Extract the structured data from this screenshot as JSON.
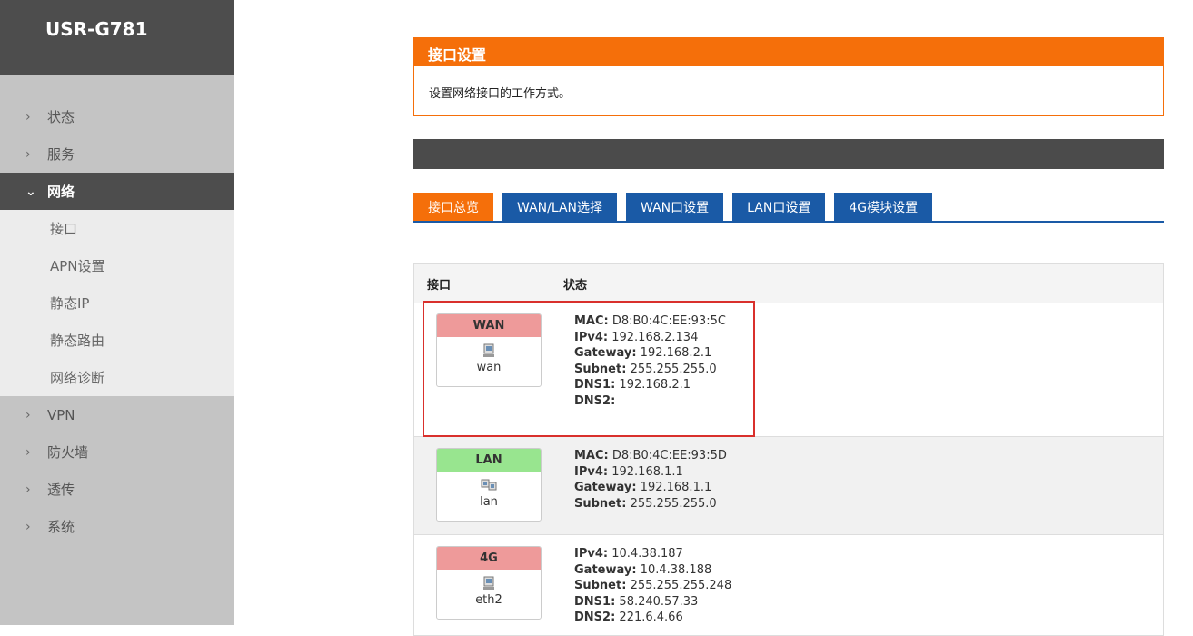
{
  "sidebar": {
    "brand": "USR-G781",
    "menu": [
      {
        "label": "状态",
        "chev": "›"
      },
      {
        "label": "服务",
        "chev": "›"
      }
    ],
    "active": {
      "label": "网络",
      "chev": "⌄"
    },
    "subitems": [
      "接口",
      "APN设置",
      "静态IP",
      "静态路由",
      "网络诊断"
    ],
    "menu_after": [
      {
        "label": "VPN",
        "chev": "›"
      },
      {
        "label": "防火墙",
        "chev": "›"
      },
      {
        "label": "透传",
        "chev": "›"
      },
      {
        "label": "系统",
        "chev": "›"
      }
    ]
  },
  "panel": {
    "title": "接口设置",
    "description": "设置网络接口的工作方式。"
  },
  "tabs": [
    "接口总览",
    "WAN/LAN选择",
    "WAN口设置",
    "LAN口设置",
    "4G模块设置"
  ],
  "table": {
    "headers": [
      "接口",
      "状态"
    ],
    "rows": [
      {
        "label": "WAN",
        "color": "#ee9a9a",
        "iface": "wan",
        "status": [
          [
            "MAC:",
            "D8:B0:4C:EE:93:5C"
          ],
          [
            "IPv4:",
            "192.168.2.134"
          ],
          [
            "Gateway:",
            "192.168.2.1"
          ],
          [
            "Subnet:",
            "255.255.255.0"
          ],
          [
            "DNS1:",
            "192.168.2.1"
          ],
          [
            "DNS2:",
            ""
          ]
        ]
      },
      {
        "label": "LAN",
        "color": "#98e58f",
        "iface": "lan",
        "status": [
          [
            "MAC:",
            "D8:B0:4C:EE:93:5D"
          ],
          [
            "IPv4:",
            "192.168.1.1"
          ],
          [
            "Gateway:",
            "192.168.1.1"
          ],
          [
            "Subnet:",
            "255.255.255.0"
          ]
        ]
      },
      {
        "label": "4G",
        "color": "#ee9a9a",
        "iface": "eth2",
        "status": [
          [
            "IPv4:",
            "10.4.38.187"
          ],
          [
            "Gateway:",
            "10.4.38.188"
          ],
          [
            "Subnet:",
            "255.255.255.248"
          ],
          [
            "DNS1:",
            "58.240.57.33"
          ],
          [
            "DNS2:",
            "221.6.4.66"
          ]
        ]
      }
    ]
  },
  "icons": {
    "network_port": "network-port-icon",
    "network_ports": "network-ports-icon"
  }
}
